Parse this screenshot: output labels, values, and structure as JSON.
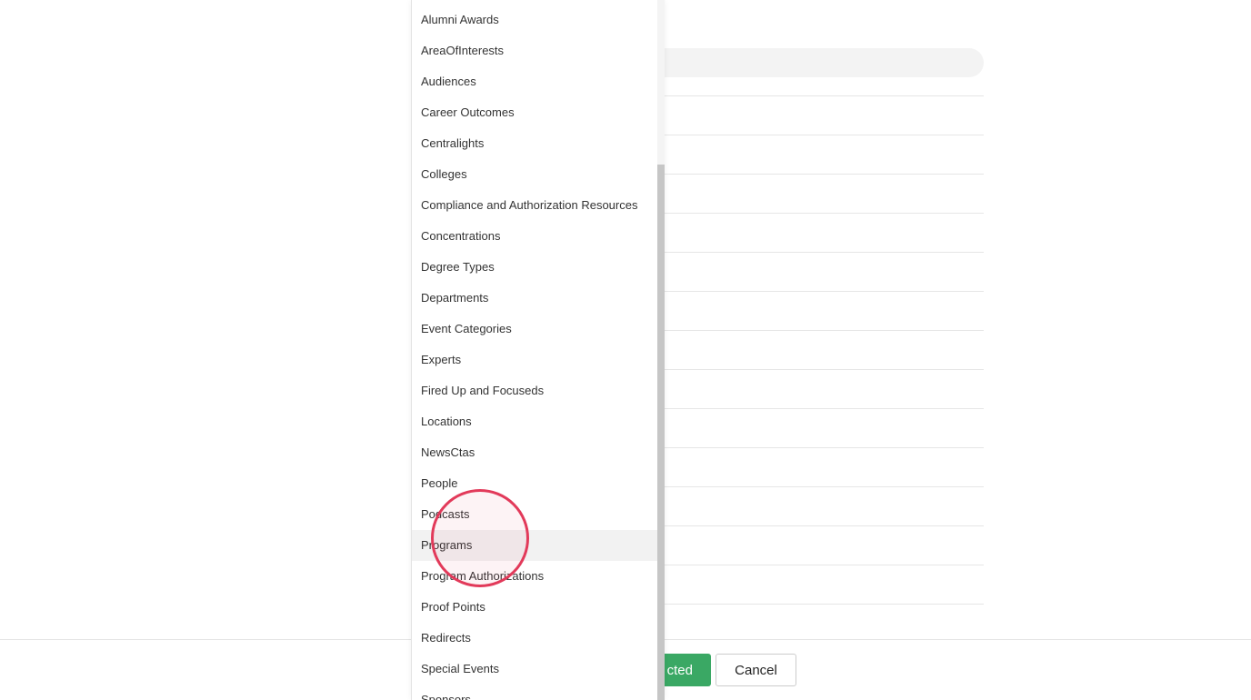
{
  "dropdown": {
    "items": [
      {
        "label": "Alumni Awards"
      },
      {
        "label": "AreaOfInterests"
      },
      {
        "label": "Audiences"
      },
      {
        "label": "Career Outcomes"
      },
      {
        "label": "Centralights"
      },
      {
        "label": "Colleges"
      },
      {
        "label": "Compliance and Authorization Resources"
      },
      {
        "label": "Concentrations"
      },
      {
        "label": "Degree Types"
      },
      {
        "label": "Departments"
      },
      {
        "label": "Event Categories"
      },
      {
        "label": "Experts"
      },
      {
        "label": "Fired Up and Focuseds"
      },
      {
        "label": "Locations"
      },
      {
        "label": "NewsCtas"
      },
      {
        "label": "People"
      },
      {
        "label": "Podcasts"
      },
      {
        "label": "Programs"
      },
      {
        "label": "Program Authorizations"
      },
      {
        "label": "Proof Points"
      },
      {
        "label": "Redirects"
      },
      {
        "label": "Special Events"
      },
      {
        "label": "Sponsors"
      }
    ],
    "hovered_item": "Programs"
  },
  "footer": {
    "primary_label": "Add Selected",
    "primary_visible_text": "cted",
    "cancel_label": "Cancel"
  },
  "colors": {
    "primary": "#3aa864",
    "click_indicator": "#e23a5a",
    "hover_bg": "#f2f2f2"
  }
}
